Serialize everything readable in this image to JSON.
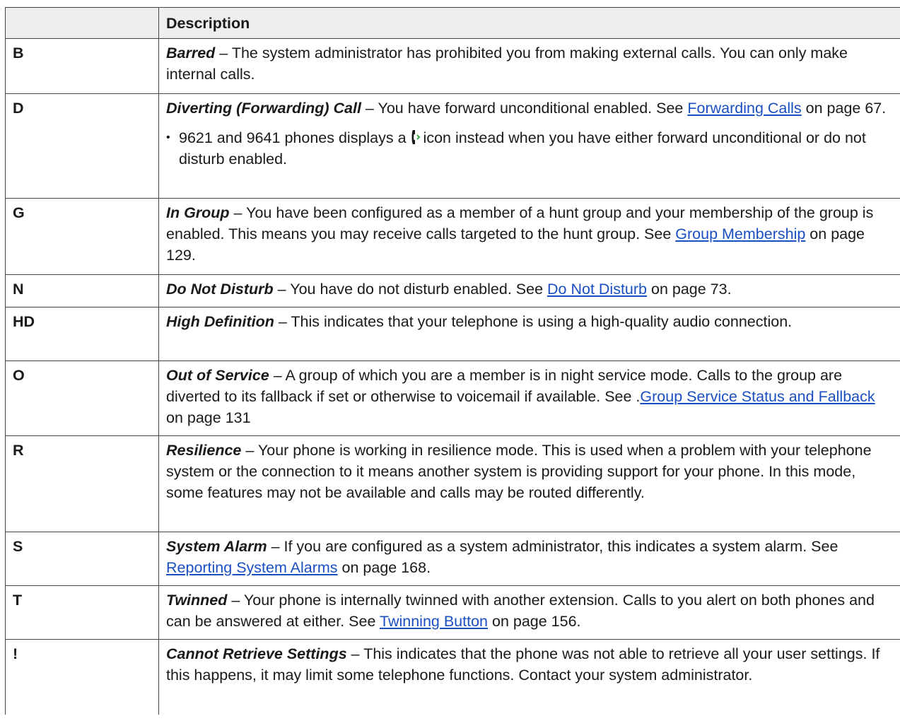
{
  "table": {
    "headers": [
      "",
      "Description"
    ],
    "rows": [
      {
        "key": "B",
        "term": "Barred",
        "desc": " – The system administrator has prohibited you from making external calls. You can only make internal calls."
      },
      {
        "key": "D",
        "term": "Diverting (Forwarding) Call",
        "desc": " – You have forward unconditional enabled. See ",
        "link": "Forwarding Calls",
        "after": " on page 67.",
        "bullet": {
          "pre": "9621 and 9641 phones displays a ",
          "icon": "forward-phone-icon",
          "post": "icon instead when you have either forward unconditional or do not disturb enabled."
        }
      },
      {
        "key": "G",
        "term": "In Group",
        "desc": " – You have been configured as a member of a hunt group and your membership of the group is enabled. This means you may receive calls targeted to the hunt group. See ",
        "link": "Group Membership",
        "after": " on page 129."
      },
      {
        "key": "N",
        "term": "Do Not Disturb",
        "desc": " – You have do not disturb enabled. See ",
        "link": "Do Not Disturb",
        "after": " on page 73."
      },
      {
        "key": "HD",
        "term": "High Definition",
        "desc": " – This indicates that your telephone is using a high-quality audio connection."
      },
      {
        "key": "O",
        "term": "Out of Service",
        "desc": " – A group of which you are a member is in night service mode. Calls to the group are diverted to its fallback if set or otherwise to voicemail if available. See .",
        "link": "Group Service Status and Fallback",
        "after": " on page 131"
      },
      {
        "key": "R",
        "term": "Resilience",
        "desc": " – Your phone is working in resilience mode. This is used when a problem with your telephone system or the connection to it means another system is providing support for your phone. In this mode, some features may not be available and calls may be routed differently."
      },
      {
        "key": "S",
        "term": "System Alarm",
        "desc": " – If you are configured as a system administrator, this indicates a system alarm. See ",
        "link": "Reporting System Alarms",
        "after": " on page 168."
      },
      {
        "key": "T",
        "term": "Twinned",
        "desc": " – Your phone is internally twinned with another extension. Calls to you alert on both phones and can be answered at either. See ",
        "link": "Twinning Button",
        "after": " on page 156."
      },
      {
        "key": "!",
        "term": "Cannot Retrieve Settings",
        "desc": " – This indicates that the phone was not able to retrieve all your user settings. If this happens, it may limit some telephone functions. Contact your system administrator."
      }
    ]
  }
}
